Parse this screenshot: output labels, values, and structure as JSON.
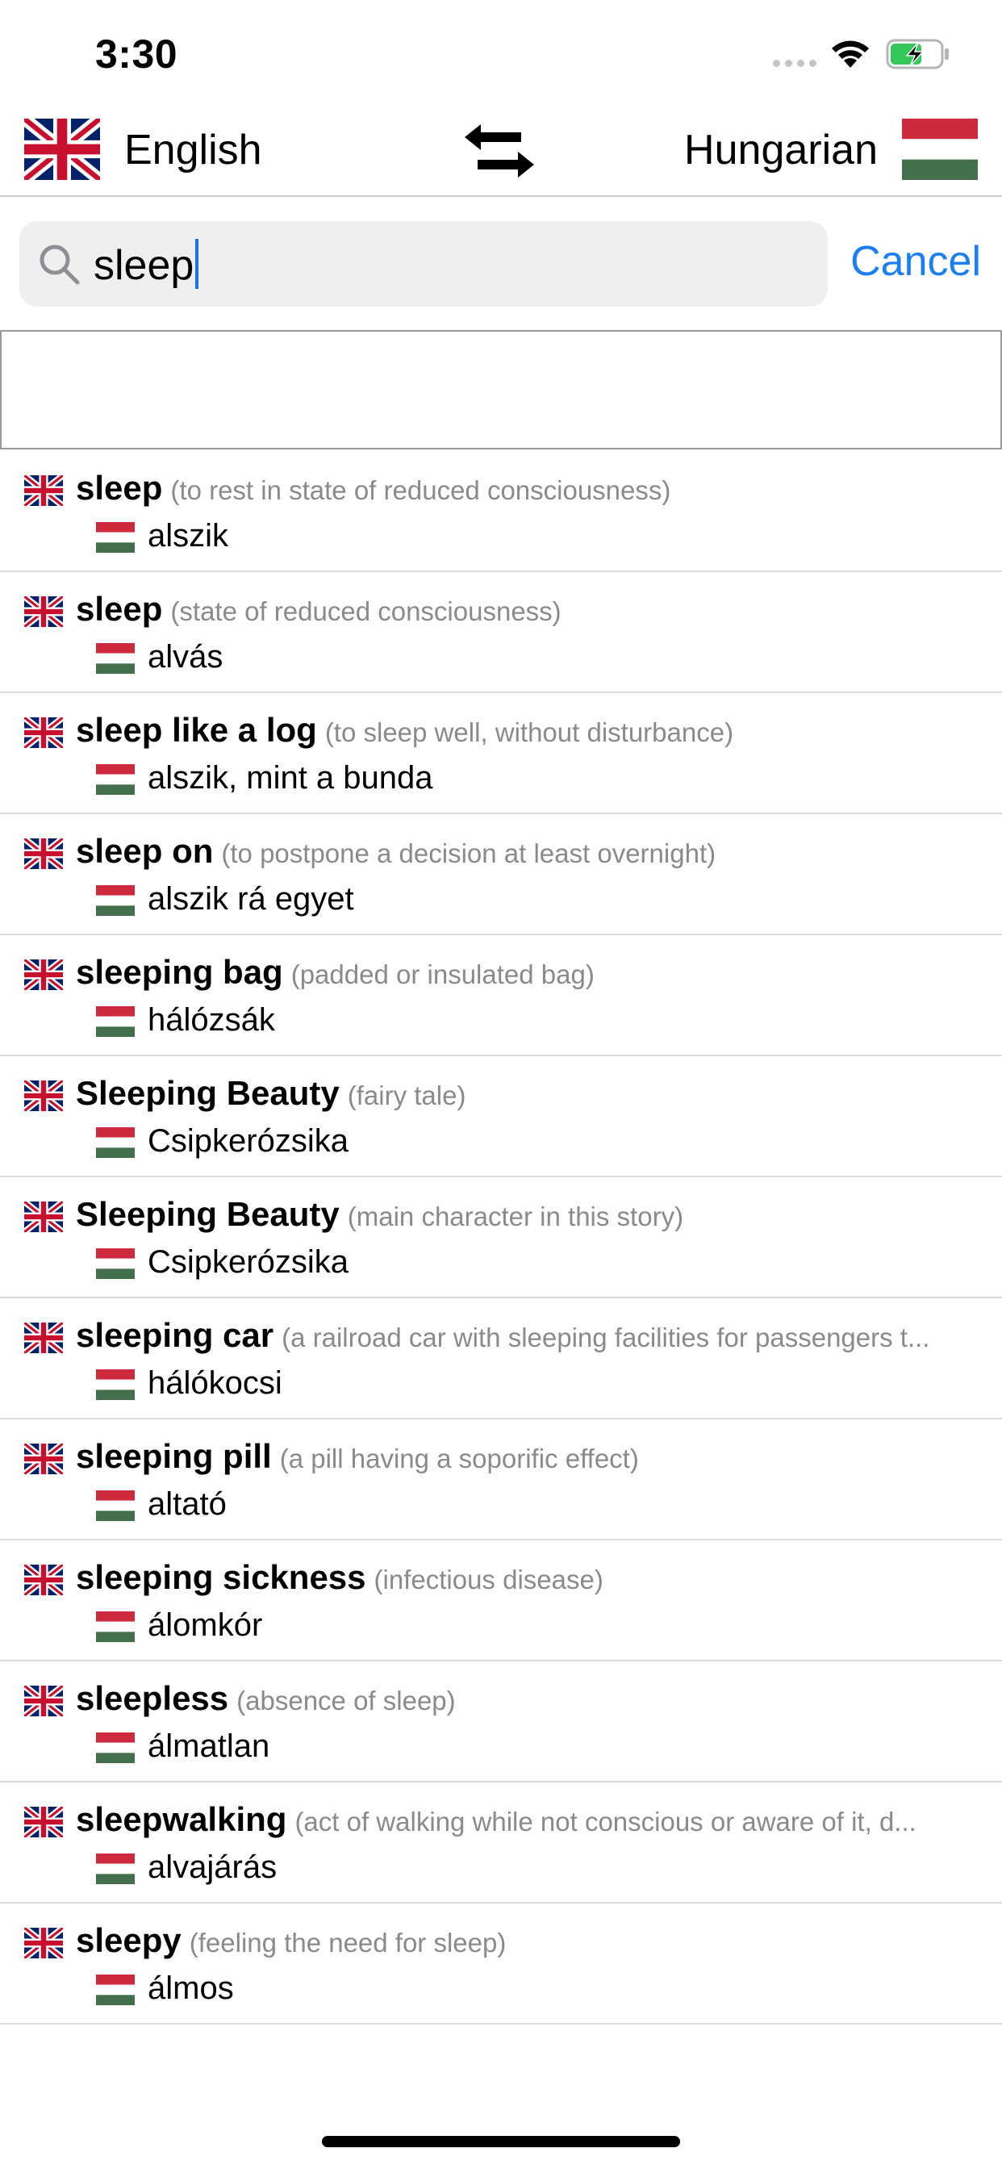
{
  "status_bar": {
    "time": "3:30"
  },
  "language_bar": {
    "from_language": "English",
    "to_language": "Hungarian"
  },
  "search": {
    "query": "sleep",
    "cancel_label": "Cancel"
  },
  "colors": {
    "accent": "#1a7ff2",
    "caret": "#1a73e8",
    "hu_red": "#cd2a3e",
    "hu_green": "#436f4d",
    "uk_blue": "#012169",
    "uk_red": "#c8102e"
  },
  "results": [
    {
      "term": "sleep",
      "description": "(to rest in state of reduced consciousness)",
      "translation": "alszik"
    },
    {
      "term": "sleep",
      "description": "(state of reduced consciousness)",
      "translation": "alvás"
    },
    {
      "term": "sleep like a log",
      "description": "(to sleep well, without disturbance)",
      "translation": "alszik, mint a bunda"
    },
    {
      "term": "sleep on",
      "description": "(to postpone a decision at least overnight)",
      "translation": "alszik rá egyet"
    },
    {
      "term": "sleeping bag",
      "description": "(padded or insulated bag)",
      "translation": "hálózsák"
    },
    {
      "term": "Sleeping Beauty",
      "description": "(fairy tale)",
      "translation": "Csipkerózsika"
    },
    {
      "term": "Sleeping Beauty",
      "description": "(main character in this story)",
      "translation": "Csipkerózsika"
    },
    {
      "term": "sleeping car",
      "description": "(a railroad car with sleeping facilities for passengers t...",
      "translation": "hálókocsi"
    },
    {
      "term": "sleeping pill",
      "description": "(a pill having a soporific effect)",
      "translation": "altató"
    },
    {
      "term": "sleeping sickness",
      "description": "(infectious disease)",
      "translation": "álomkór"
    },
    {
      "term": "sleepless",
      "description": "(absence of sleep)",
      "translation": "álmatlan"
    },
    {
      "term": "sleepwalking",
      "description": "(act of walking while not conscious or aware of it, d...",
      "translation": "alvajárás"
    },
    {
      "term": "sleepy",
      "description": "(feeling the need for sleep)",
      "translation": "álmos"
    }
  ]
}
